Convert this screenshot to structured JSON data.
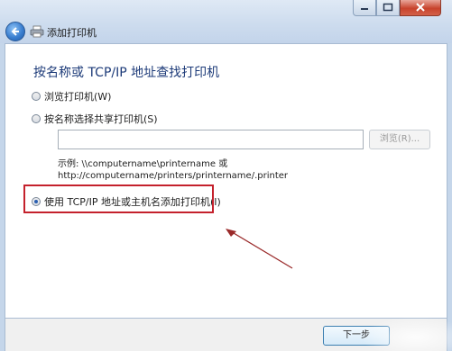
{
  "window": {
    "title": "添加打印机",
    "back_icon": "back-arrow-icon",
    "printer_icon": "printer-icon"
  },
  "heading": "按名称或 TCP/IP 地址查找打印机",
  "options": [
    {
      "label": "浏览打印机(W)",
      "checked": false
    },
    {
      "label": "按名称选择共享打印机(S)",
      "checked": false
    },
    {
      "label": "使用 TCP/IP 地址或主机名添加打印机(I)",
      "checked": true
    }
  ],
  "shared_printer": {
    "input_value": "",
    "browse_label": "浏览(R)...",
    "example_line1": "示例: \\\\computername\\printername 或",
    "example_line2": "http://computername/printers/printername/.printer"
  },
  "footer": {
    "next_label": "下一步"
  },
  "colors": {
    "highlight": "#c4212c",
    "heading": "#1c3a78",
    "arrow": "#9a2a2a"
  }
}
